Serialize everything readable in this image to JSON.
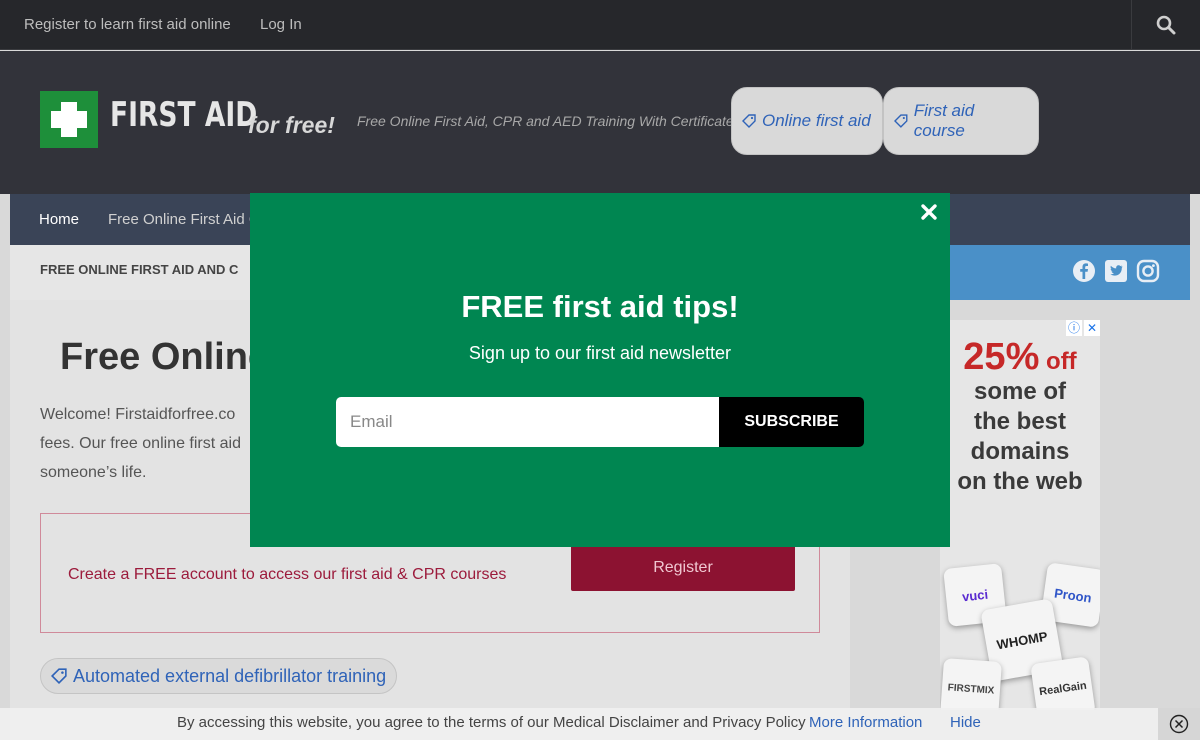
{
  "topbar": {
    "register_link": "Register to learn first aid online",
    "login_link": "Log In"
  },
  "header": {
    "logo_text": "FIRST AID",
    "logo_sub": "for free!",
    "tagline": "Free Online First Aid, CPR and AED Training With Certificates",
    "tags": [
      "Online first aid",
      "First aid course"
    ]
  },
  "nav": {
    "home": "Home",
    "item2": "Free Online First Aid C"
  },
  "subbar": {
    "crumb": "FREE ONLINE FIRST AID AND C"
  },
  "content": {
    "title": "Free Online",
    "welcome": "Welcome! Firstaidforfree.co fees. Our free online first aid someone’s life.",
    "register_prompt": "Create a FREE account to access our first aid & CPR courses",
    "register_button": "Register",
    "aed_tag": "Automated external defibrillator training"
  },
  "ad": {
    "pct": "25%",
    "off": "off",
    "line2": "some of",
    "line3": "the best",
    "line4": "domains",
    "line5": "on the web",
    "cards": [
      "vuci",
      "Proon",
      "WHOMP",
      "FIRSTMIX",
      "RealGain"
    ]
  },
  "modal": {
    "title": "FREE first aid tips!",
    "subtitle": "Sign up to our first aid newsletter",
    "email_placeholder": "Email",
    "subscribe": "SUBSCRIBE"
  },
  "cookie": {
    "message": "By accessing this website, you agree to the terms of our Medical Disclaimer and Privacy Policy",
    "more": "More Information",
    "hide": "Hide"
  },
  "colors": {
    "modal_bg": "#008651",
    "nav_bg": "#3a4457",
    "header_bg": "#32333a",
    "accent_blue": "#2f63b8",
    "register_red": "#8c1231"
  }
}
